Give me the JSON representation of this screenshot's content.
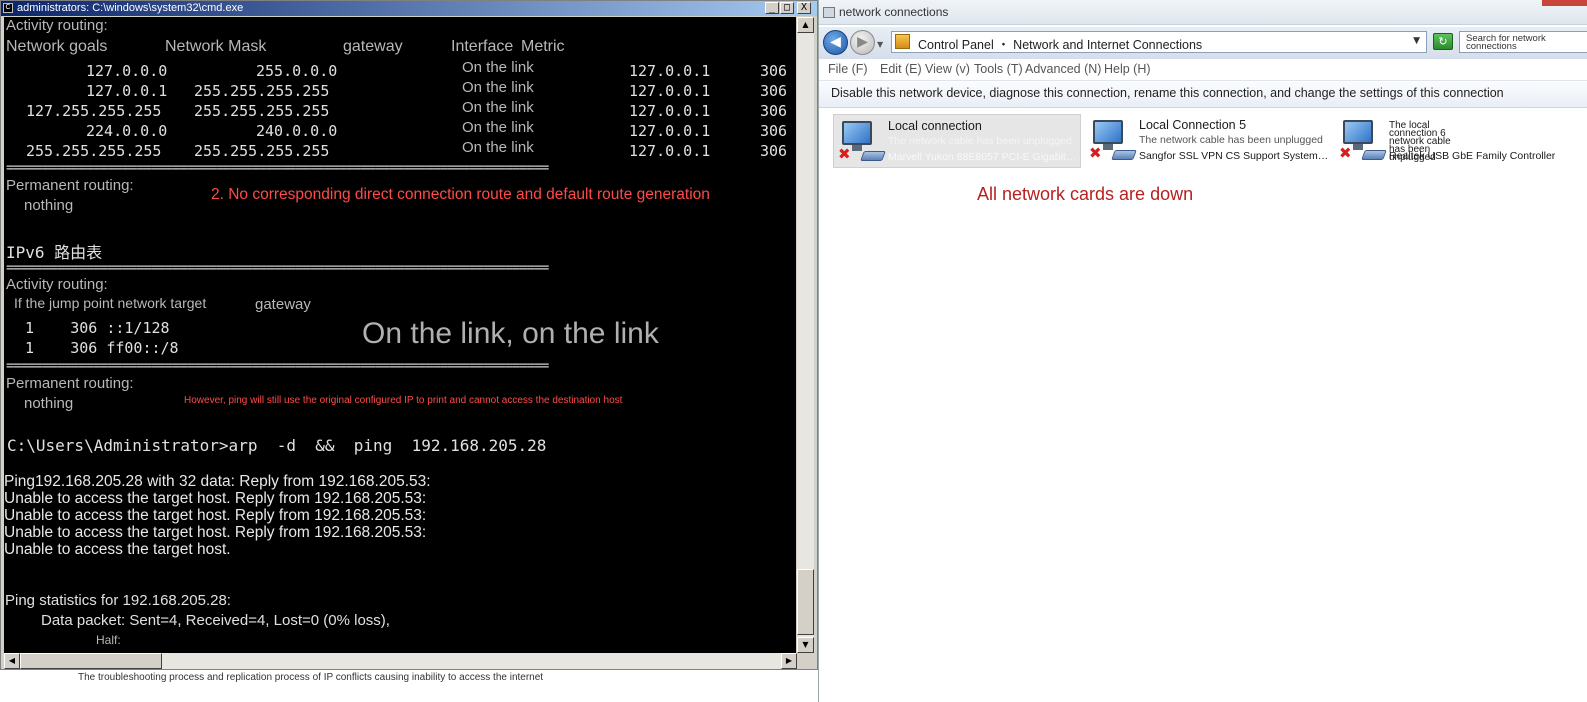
{
  "cmd": {
    "title": "administrators: C:\\windows\\system32\\cmd.exe",
    "buttons": {
      "minimize": "_",
      "maximize": "□",
      "close": "X"
    },
    "ipv4_active_header": "Activity routing:",
    "ipv4_cols": {
      "dest": "Network goals",
      "mask": "Network Mask",
      "gateway": "gateway",
      "iface": "Interface",
      "metric": "Metric"
    },
    "ipv4_rows": [
      {
        "dest": "127.0.0.0",
        "mask": "255.0.0.0",
        "gateway": "On the link",
        "iface": "127.0.0.1",
        "metric": "306"
      },
      {
        "dest": "127.0.0.1",
        "mask": "255.255.255.255",
        "gateway": "On the link",
        "iface": "127.0.0.1",
        "metric": "306"
      },
      {
        "dest": "127.255.255.255",
        "mask": "255.255.255.255",
        "gateway": "On the link",
        "iface": "127.0.0.1",
        "metric": "306"
      },
      {
        "dest": "224.0.0.0",
        "mask": "240.0.0.0",
        "gateway": "On the link",
        "iface": "127.0.0.1",
        "metric": "306"
      },
      {
        "dest": "255.255.255.255",
        "mask": "255.255.255.255",
        "gateway": "On the link",
        "iface": "127.0.0.1",
        "metric": "306"
      }
    ],
    "separator": "===========================================================================",
    "permanent_header": "Permanent routing:",
    "permanent_value": "nothing",
    "annotation_1": "2. No corresponding direct connection route and default route generation",
    "ipv6_header": "IPv6 路由表",
    "ipv6_active_header": "Activity routing:",
    "ipv6_cols": {
      "jump": "If the jump point network target",
      "gateway": "gateway"
    },
    "ipv6_rows": [
      "  1    306 ::1/128",
      "  1    306 ff00::/8"
    ],
    "ipv6_annotation": "On the link, on the link",
    "permanent_header_2": "Permanent routing:",
    "permanent_value_2": "nothing",
    "annotation_2": "However, ping will still use the original configured IP to print and cannot access the destination host",
    "prompt_line": "C:\\Users\\Administrator>arp  -d  &&  ping  192.168.205.28",
    "ping_output": "Ping192.168.205.28 with 32 data: Reply from 192.168.205.53: Unable to access the target host. Reply from 192.168.205.53: Unable to access the target host. Reply from 192.168.205.53: Unable to access the target host. Reply from 192.168.205.53: Unable to access the target host.",
    "stats_header": "Ping statistics for 192.168.205.28:",
    "stats_line": "Data packet: Sent=4, Received=4, Lost=0 (0% loss),",
    "half_line": "Half:",
    "arrows": {
      "up": "▲",
      "down": "▼",
      "left": "◀",
      "right": "▶"
    }
  },
  "caption": "The troubleshooting process and replication process of IP conflicts causing inability to access the internet",
  "net": {
    "title": "network connections",
    "nav": {
      "back": "◀",
      "forward": "▶",
      "dropdown": "▼"
    },
    "address": "Control Panel ・ Network and Internet Connections",
    "address_dropdown": "▼",
    "refresh": "↻",
    "search_placeholder": "Search for network connections",
    "menu": [
      "File (F)",
      "Edit (E)",
      "View (v)",
      "Tools (T)",
      "Advanced (N)",
      "Help (H)"
    ],
    "command_text": "Disable this network device, diagnose this connection, rename this connection, and change the settings of this connection",
    "adapters": [
      {
        "name": "Local connection",
        "status": "The network cable has been unplugged",
        "device": "Marvell Yukon 88E8057 PCI-E Gigabit…",
        "x": "✖"
      },
      {
        "name": "Local Connection 5",
        "status": "The network cable has been unplugged",
        "device": "Sangfor SSL VPN CS Support System…",
        "x": "✖"
      },
      {
        "name": "The local connection 6 network cable has been unplugged",
        "status": "",
        "device": "Realtek USB GbE Family Controller",
        "x": "✖"
      }
    ],
    "annotation": "All network cards are down"
  }
}
